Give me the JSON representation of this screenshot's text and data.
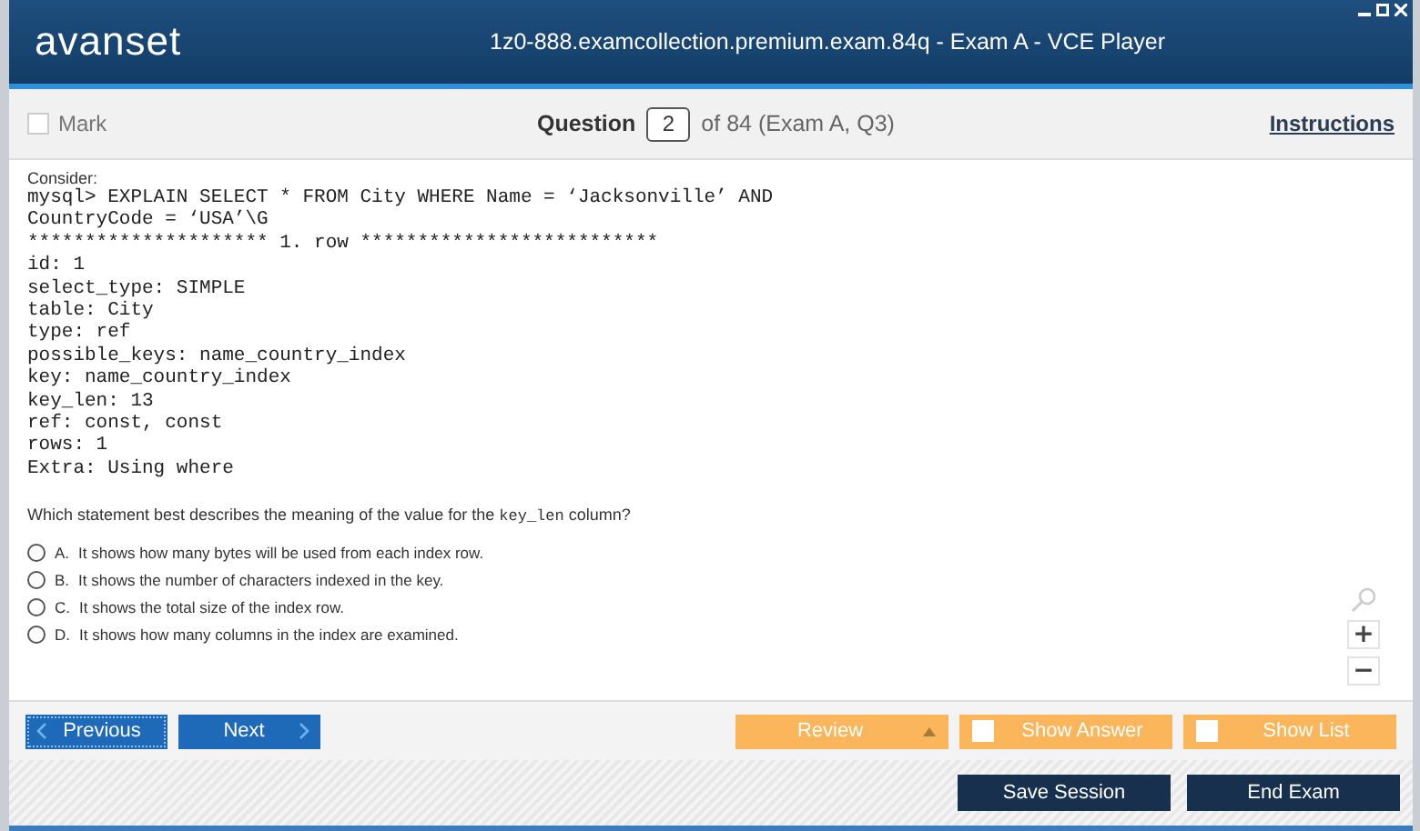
{
  "header": {
    "logo": "avanset",
    "title": "1z0-888.examcollection.premium.exam.84q - Exam A - VCE Player"
  },
  "toolbar": {
    "mark": {
      "label": "Mark",
      "checked": false
    },
    "question_label": "Question",
    "question_number": "2",
    "question_of": "of 84 (Exam A, Q3)",
    "instructions": "Instructions"
  },
  "question": {
    "intro": "Consider:",
    "code_lines": [
      "mysql> EXPLAIN SELECT * FROM City WHERE Name = ‘Jacksonville’ AND",
      "CountryCode = ‘USA’\\G",
      "********************* 1. row **************************",
      "id: 1",
      "select_type: SIMPLE",
      "table: City",
      "type: ref",
      "possible_keys: name_country_index",
      "key: name_country_index",
      "key_len: 13",
      "ref: const, const",
      "rows: 1",
      "Extra: Using where"
    ],
    "prompt_before": "Which statement best describes the meaning of the value for the",
    "prompt_code": "key_len",
    "prompt_after": "column?",
    "options": [
      {
        "letter": "A.",
        "text": "It shows how many bytes will be used from each index row.",
        "selected": false
      },
      {
        "letter": "B.",
        "text": "It shows the number of characters indexed in the key.",
        "selected": false
      },
      {
        "letter": "C.",
        "text": "It shows the total size of the index row.",
        "selected": false
      },
      {
        "letter": "D.",
        "text": "It shows how many columns in the index are examined.",
        "selected": false
      }
    ]
  },
  "zoom": {
    "plus": "+",
    "minus": "−"
  },
  "nav": {
    "previous": "Previous",
    "next": "Next",
    "review": "Review",
    "show_answer": {
      "label": "Show Answer",
      "checked": false
    },
    "show_list": {
      "label": "Show List",
      "checked": false
    }
  },
  "footer": {
    "save": "Save Session",
    "end": "End Exam"
  }
}
